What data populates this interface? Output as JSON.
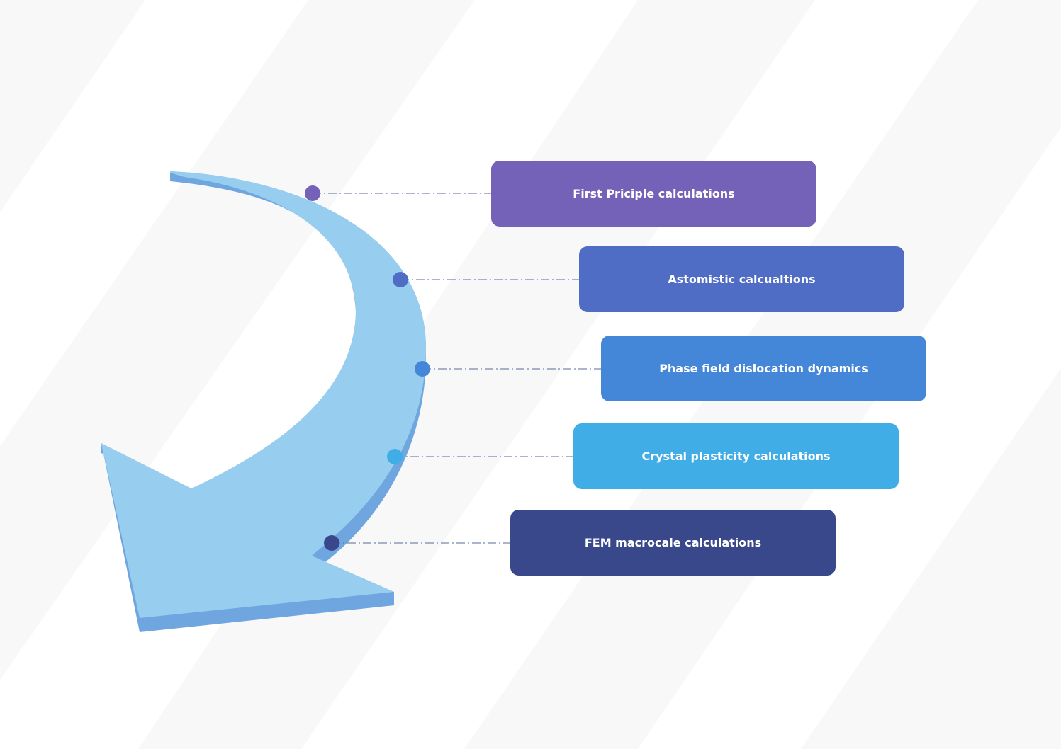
{
  "steps": [
    {
      "label": "First Priciple calculations",
      "color": "#7461b8"
    },
    {
      "label": "Astomistic calcualtions",
      "color": "#506dc6"
    },
    {
      "label": "Phase field dislocation dynamics",
      "color": "#4487d8"
    },
    {
      "label": "Crystal plasticity calculations",
      "color": "#40ade6"
    },
    {
      "label": "FEM macrocale calculations",
      "color": "#39488a"
    }
  ],
  "arrow": {
    "face_color": "#97cdee",
    "side_color": "#6fa6df"
  }
}
